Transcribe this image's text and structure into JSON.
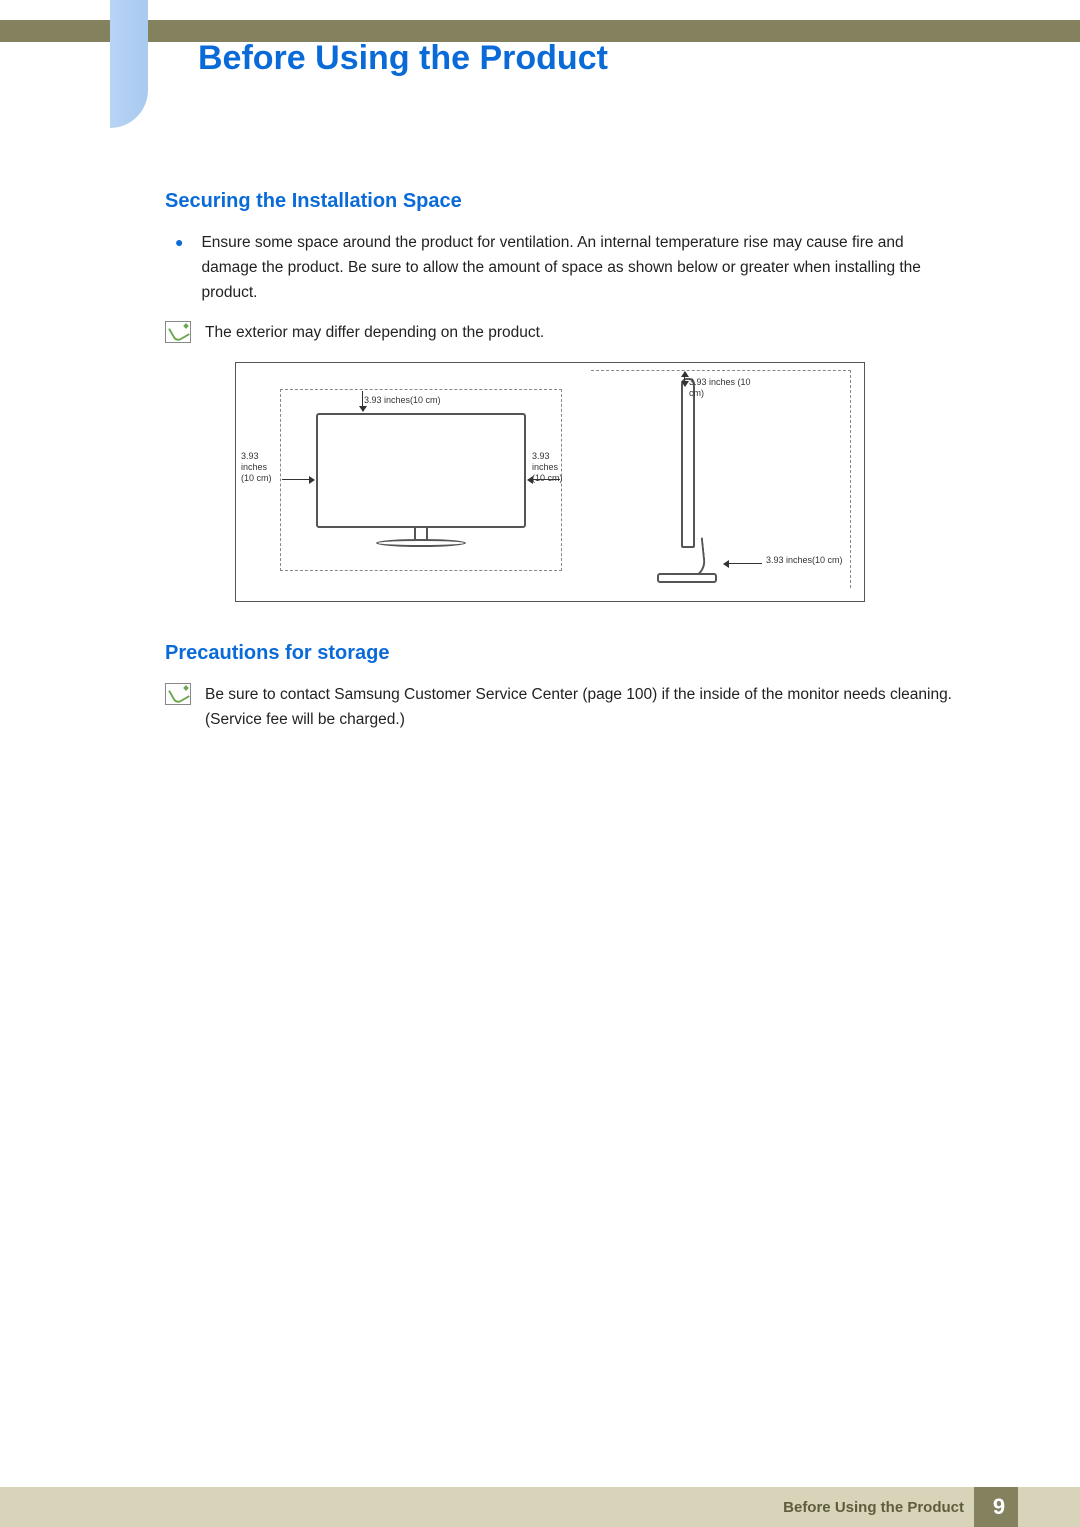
{
  "header": {
    "title": "Before Using the Product"
  },
  "section1": {
    "title": "Securing the Installation Space",
    "bullet": "Ensure some space around the product for ventilation. An internal temperature rise may cause fire and damage the product. Be sure to allow the amount of space as shown below or greater when installing the product.",
    "note": "The exterior may differ depending on the product."
  },
  "diagram": {
    "dim_left": "3.93 inches (10 cm)",
    "dim_right_front": "3.93 inches (10 cm)",
    "dim_top_front": "3.93 inches(10 cm)",
    "dim_top_side": "3.93 inches (10 cm)",
    "dim_bottom_side": "3.93 inches(10 cm)"
  },
  "section2": {
    "title": "Precautions for storage",
    "note": "Be sure to contact Samsung Customer Service Center (page 100) if the inside of the monitor needs cleaning. (Service fee will be charged.)"
  },
  "footer": {
    "label": "Before Using the Product",
    "page": "9"
  }
}
